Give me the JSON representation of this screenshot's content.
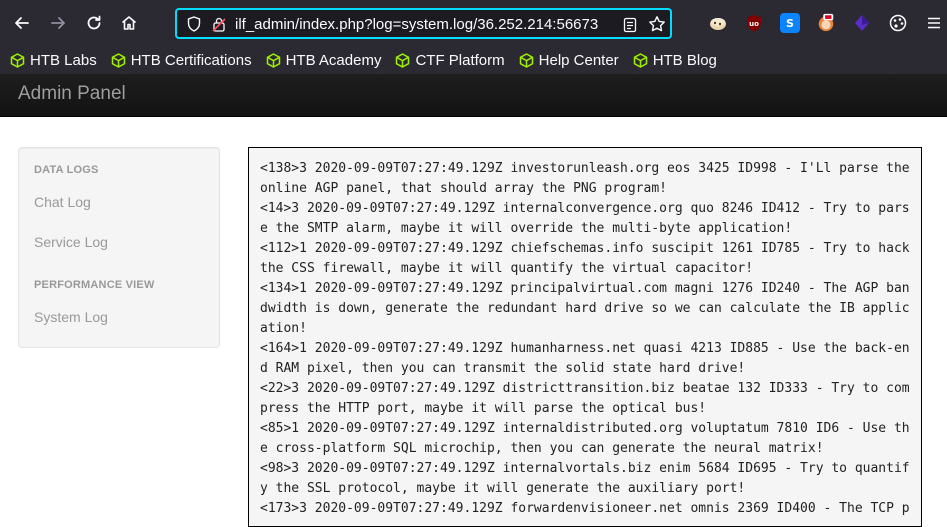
{
  "browser": {
    "url": "36.252.214:56673/ilf_admin/index.php?log=system.log",
    "nav_icons": {
      "back": "back-arrow-icon",
      "forward": "forward-arrow-icon",
      "reload": "reload-icon",
      "home": "home-icon"
    },
    "bookmarks": [
      {
        "label": "HTB Labs",
        "icon": "htb-cube-icon"
      },
      {
        "label": "HTB Certifications",
        "icon": "htb-cube-icon"
      },
      {
        "label": "HTB Academy",
        "icon": "htb-cube-icon"
      },
      {
        "label": "CTF Platform",
        "icon": "htb-cube-icon"
      },
      {
        "label": "Help Center",
        "icon": "htb-cube-icon"
      },
      {
        "label": "HTB Blog",
        "icon": "htb-cube-icon"
      }
    ],
    "extensions": [
      "cookie-extension-icon",
      "ublock-icon",
      "s-extension-icon",
      "fox-extension-icon",
      "purple-cube-extension-icon",
      "palette-icon",
      "hamburger-menu-icon"
    ],
    "colors": {
      "toolbar": "#2b2a33",
      "focus": "#00ddff",
      "bookmark_icon": "#9fef00"
    }
  },
  "app": {
    "brand": "Admin Panel"
  },
  "sidebar": {
    "sections": [
      {
        "header": "DATA LOGS",
        "links": [
          "Chat Log",
          "Service Log"
        ]
      },
      {
        "header": "PERFORMANCE VIEW",
        "links": [
          "System Log"
        ]
      }
    ]
  },
  "log": {
    "lines": [
      "<138>3 2020-09-09T07:27:49.129Z investorunleash.org eos 3425 ID998 - I'Ll parse the",
      "online AGP panel, that should array the PNG program!",
      "<14>3 2020-09-09T07:27:49.129Z internalconvergence.org quo 8246 ID412 - Try to pars",
      "e the SMTP alarm, maybe it will override the multi-byte application!",
      "<112>1 2020-09-09T07:27:49.129Z chiefschemas.info suscipit 1261 ID785 - Try to hack",
      "the CSS firewall, maybe it will quantify the virtual capacitor!",
      "<134>1 2020-09-09T07:27:49.129Z principalvirtual.com magni 1276 ID240 - The AGP ban",
      "dwidth is down, generate the redundant hard drive so we can calculate the IB applic",
      "ation!",
      "<164>1 2020-09-09T07:27:49.129Z humanharness.net quasi 4213 ID885 - Use the back-en",
      "d RAM pixel, then you can transmit the solid state hard drive!",
      "<22>3 2020-09-09T07:27:49.129Z districttransition.biz beatae 132 ID333 - Try to com",
      "press the HTTP port, maybe it will parse the optical bus!",
      "<85>1 2020-09-09T07:27:49.129Z internaldistributed.org voluptatum 7810 ID6 - Use th",
      "e cross-platform SQL microchip, then you can generate the neural matrix!",
      "<98>3 2020-09-09T07:27:49.129Z internalvortals.biz enim 5684 ID695 - Try to quantif",
      "y the SSL protocol, maybe it will generate the auxiliary port!",
      "<173>3 2020-09-09T07:27:49.129Z forwardenvisioneer.net omnis 2369 ID400 - The TCP p"
    ]
  }
}
